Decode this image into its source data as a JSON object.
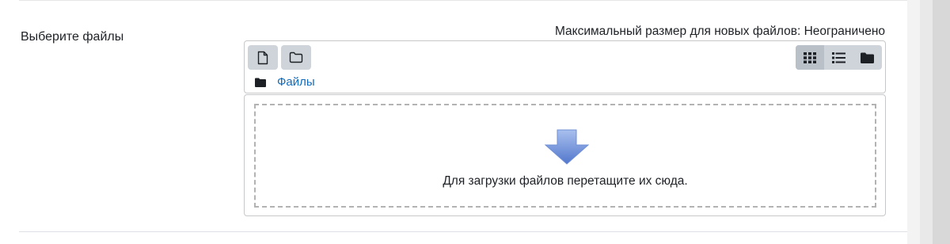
{
  "field": {
    "label": "Выберите файлы",
    "max_size_text": "Максимальный размер для новых файлов: Неограничено"
  },
  "toolbar": {
    "add_file_icon": "file-icon",
    "create_folder_icon": "folder-icon",
    "views": [
      {
        "icon": "grid-view-icon",
        "active": true
      },
      {
        "icon": "list-view-icon",
        "active": false
      },
      {
        "icon": "tree-view-icon",
        "active": false
      }
    ]
  },
  "path": {
    "icon": "folder-filled-icon",
    "label": "Файлы"
  },
  "dropzone": {
    "icon": "download-arrow-icon",
    "text": "Для загрузки файлов перетащите их сюда."
  },
  "colors": {
    "link": "#0f6cbf",
    "button_bg": "#ced4da",
    "arrow_top": "#a9c0ee",
    "arrow_bottom": "#5277cc"
  }
}
